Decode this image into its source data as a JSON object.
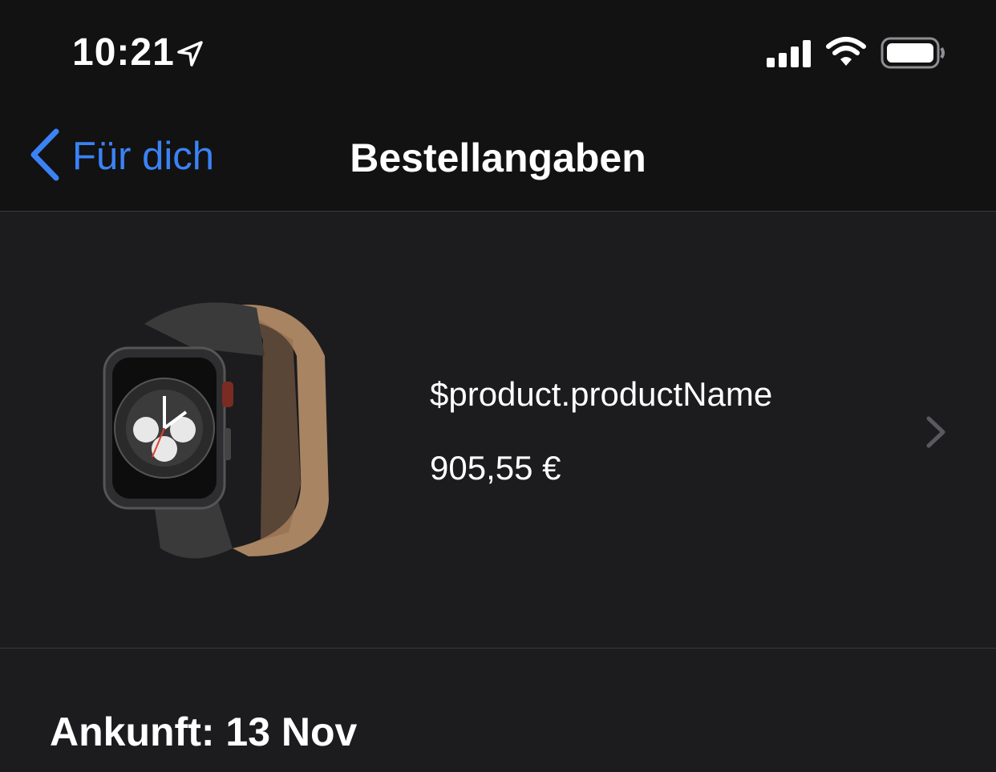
{
  "status_bar": {
    "time": "10:21",
    "icons": [
      "location-arrow-icon",
      "cellular-signal-icon",
      "wifi-icon",
      "battery-icon"
    ]
  },
  "nav": {
    "back_label": "Für dich",
    "title": "Bestellangaben"
  },
  "product": {
    "name": "$product.productName",
    "price": "905,55 €",
    "image": "apple-watch-product-image"
  },
  "arrival": "Ankunft: 13 Nov",
  "colors": {
    "accent": "#3b82f6",
    "background": "#1c1c1e",
    "bar_background": "#121212",
    "separator": "#3a3a3c"
  }
}
